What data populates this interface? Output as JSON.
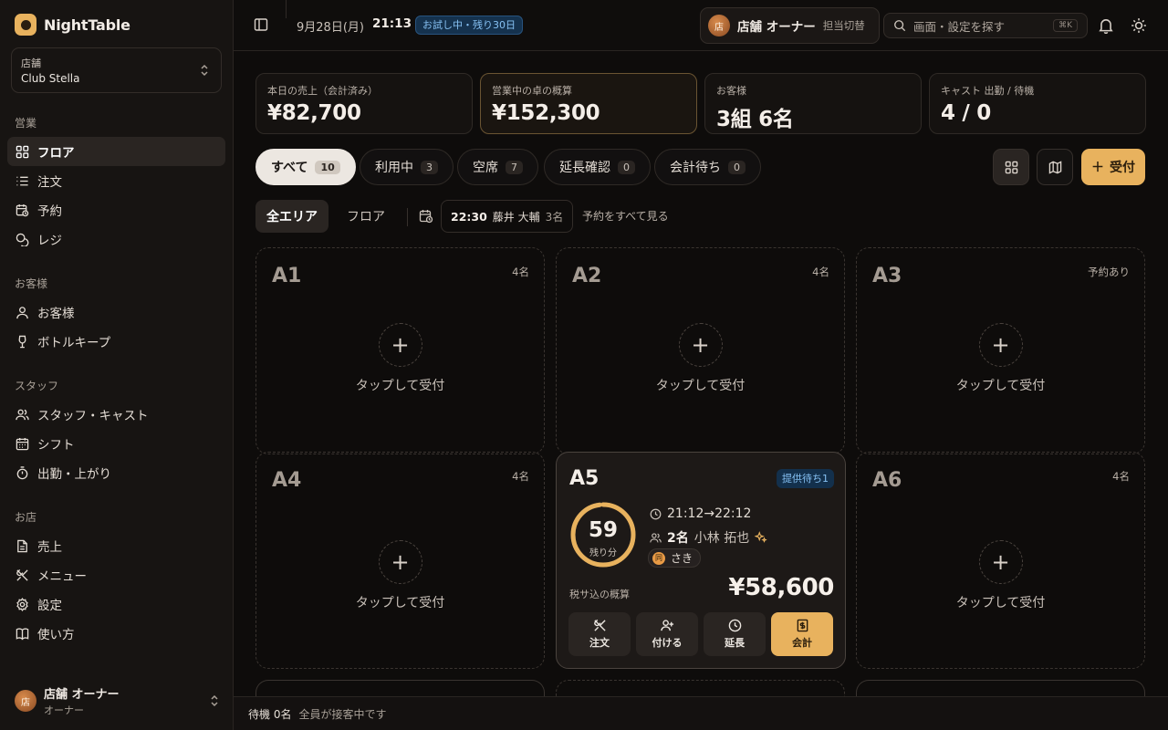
{
  "app": {
    "name": "NightTable"
  },
  "sidebar": {
    "store_label": "店舗",
    "store_value": "Club Stella",
    "sections": [
      "営業",
      "お客様",
      "スタッフ",
      "お店"
    ],
    "items": [
      {
        "label": "フロア",
        "icon": "grid-icon"
      },
      {
        "label": "注文",
        "icon": "list-icon"
      },
      {
        "label": "予約",
        "icon": "calendar-clock-icon"
      },
      {
        "label": "レジ",
        "icon": "coins-icon"
      },
      {
        "label": "お客様",
        "icon": "user-icon"
      },
      {
        "label": "ボトルキープ",
        "icon": "wine-icon"
      },
      {
        "label": "スタッフ・キャスト",
        "icon": "users-icon"
      },
      {
        "label": "シフト",
        "icon": "calendar-icon"
      },
      {
        "label": "出勤・上がり",
        "icon": "timer-icon"
      },
      {
        "label": "売上",
        "icon": "file-icon"
      },
      {
        "label": "メニュー",
        "icon": "utensils-icon"
      },
      {
        "label": "設定",
        "icon": "gear-icon"
      },
      {
        "label": "使い方",
        "icon": "book-icon"
      }
    ],
    "user": {
      "avatar": "店",
      "name": "店舗 オーナー",
      "role": "オーナー"
    }
  },
  "header": {
    "date": "9月28日(月)",
    "time": "21:13",
    "trial": "お試し中・残り30日",
    "owner_avatar": "店",
    "owner_name": "店舗 オーナー",
    "switch_label": "担当切替",
    "search_placeholder": "画面・設定を探す",
    "search_kbd": "⌘K"
  },
  "stats": [
    {
      "label": "本日の売上（会計済み）",
      "value": "¥82,700"
    },
    {
      "label": "営業中の卓の概算",
      "value": "¥152,300"
    },
    {
      "label": "お客様",
      "value": "3組 6名"
    },
    {
      "label": "キャスト 出勤 / 待機",
      "value": "4 / 0"
    }
  ],
  "filters": [
    {
      "label": "すべて",
      "count": "10"
    },
    {
      "label": "利用中",
      "count": "3"
    },
    {
      "label": "空席",
      "count": "7"
    },
    {
      "label": "延長確認",
      "count": "0"
    },
    {
      "label": "会計待ち",
      "count": "0"
    }
  ],
  "add_label": "受付",
  "areas": [
    "全エリア",
    "フロア"
  ],
  "next_reservation": {
    "time": "22:30",
    "name": "藤井 大輔",
    "party": "3名"
  },
  "see_all_reservations": "予約をすべて見る",
  "empty_tap_label": "タップして受付",
  "tables": [
    {
      "name": "A1",
      "cap": "4名"
    },
    {
      "name": "A2",
      "cap": "4名"
    },
    {
      "name": "A3",
      "cap": "予約あり"
    },
    {
      "name": "A4",
      "cap": "4名"
    },
    {
      "name": "A6",
      "cap": "4名"
    }
  ],
  "active_table": {
    "name": "A5",
    "badge": "提供待ち1",
    "remaining": "59",
    "remaining_label": "残り分",
    "remaining_fraction": 0.98,
    "time_range": "21:12→22:12",
    "guest_count": "2名",
    "guest_name": "小林 拓也",
    "cast_tag": "同",
    "cast_name": "さき",
    "estimate_label": "税サ込の概算",
    "estimate": "¥58,600",
    "actions": [
      "注文",
      "付ける",
      "延長",
      "会計"
    ]
  },
  "footer": {
    "waiting": "待機 0名",
    "note": "全員が接客中です"
  },
  "colors": {
    "accent": "#e8b25e",
    "info": "#86c1f3",
    "bg": "#0e0c0b"
  }
}
